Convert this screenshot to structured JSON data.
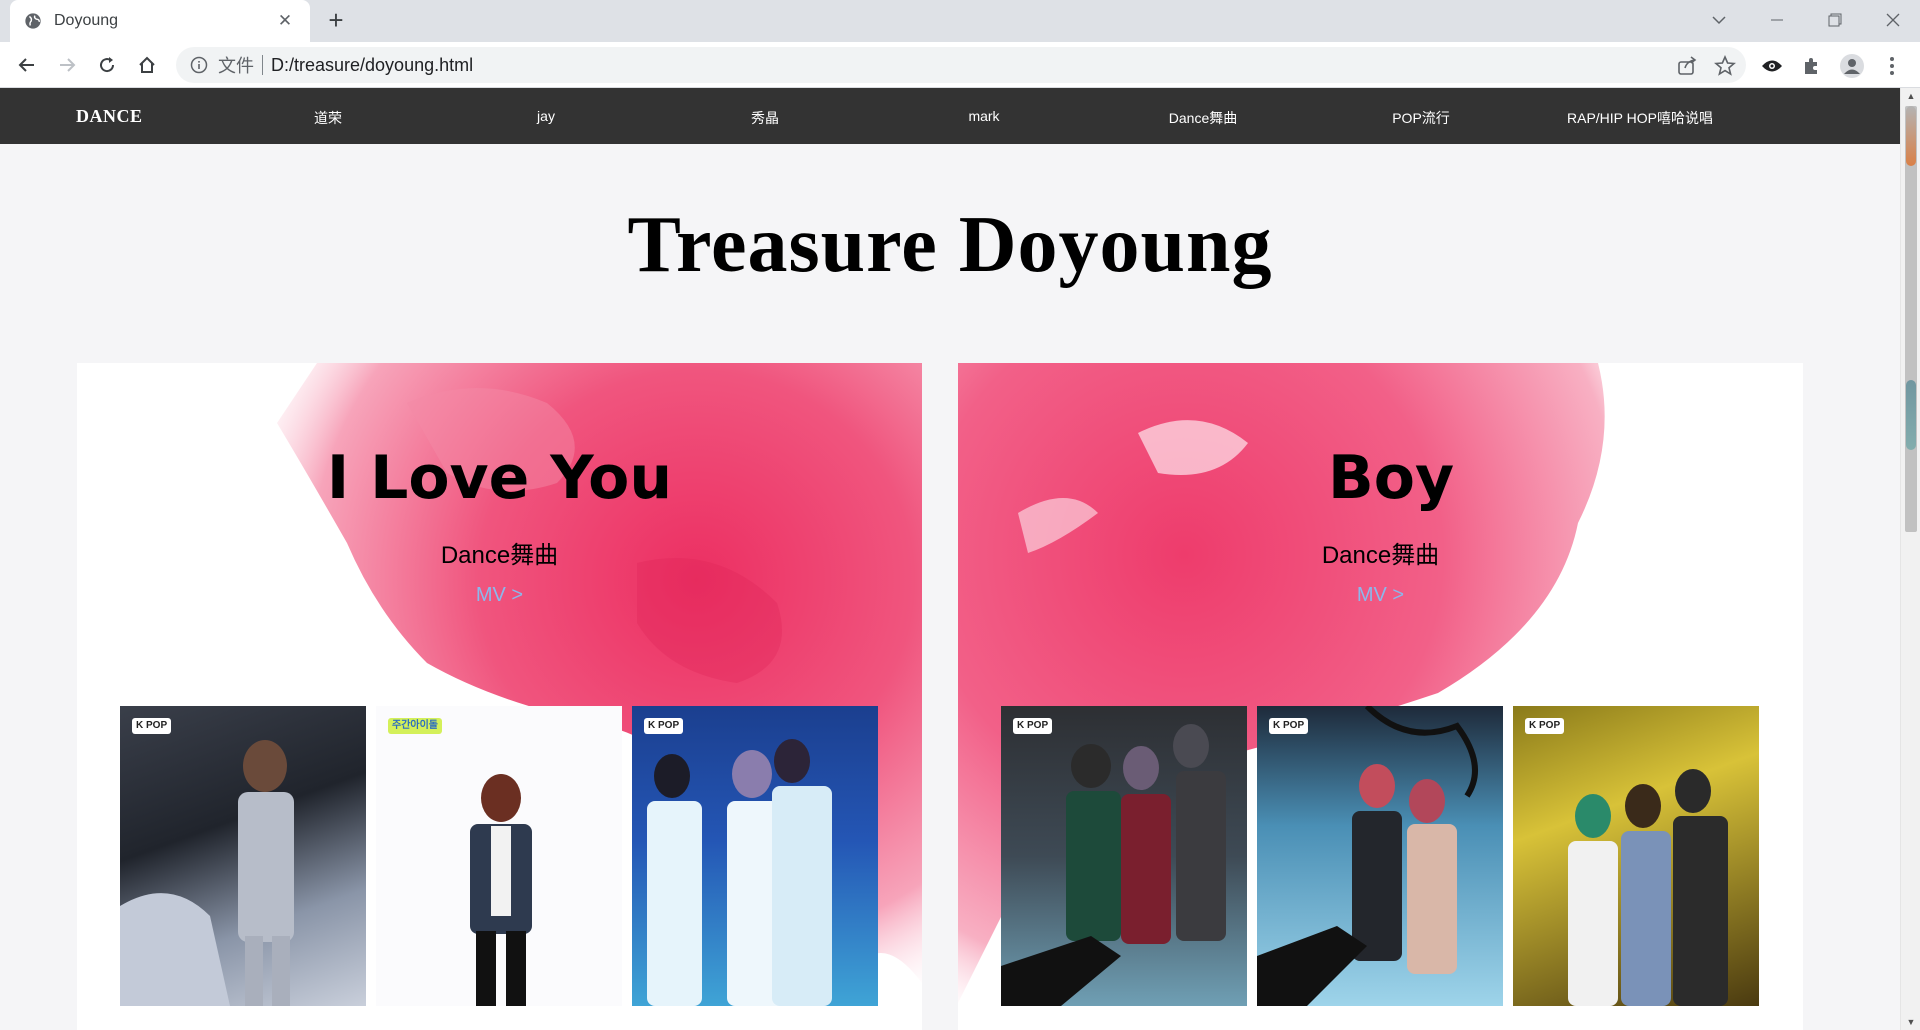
{
  "browser": {
    "tab_title": "Doyoung",
    "tab_close": "✕",
    "new_tab": "+",
    "scheme_label": "文件",
    "url": "D:/treasure/doyoung.html"
  },
  "site": {
    "brand": "DANCE",
    "nav_items": [
      "道荣",
      "jay",
      "秀晶",
      "mark",
      "Dance舞曲",
      "POP流行",
      "RAP/HIP HOP嘻哈说唱"
    ],
    "page_title": "Treasure Doyoung"
  },
  "cards": [
    {
      "title": "I Love You",
      "genre": "Dance舞曲",
      "mv_label": "MV  >",
      "photos": [
        {
          "badge": "K POP"
        },
        {
          "badge": "주간아이돌"
        },
        {
          "badge": "K POP"
        }
      ]
    },
    {
      "title": "Boy",
      "genre": "Dance舞曲",
      "mv_label": "MV  >",
      "photos": [
        {
          "badge": "K POP"
        },
        {
          "badge": "K POP"
        },
        {
          "badge": "K POP"
        }
      ]
    }
  ],
  "colors": {
    "nav_bg": "#333333",
    "splash": "#e8446f",
    "mv_link": "#8bb8ec"
  }
}
